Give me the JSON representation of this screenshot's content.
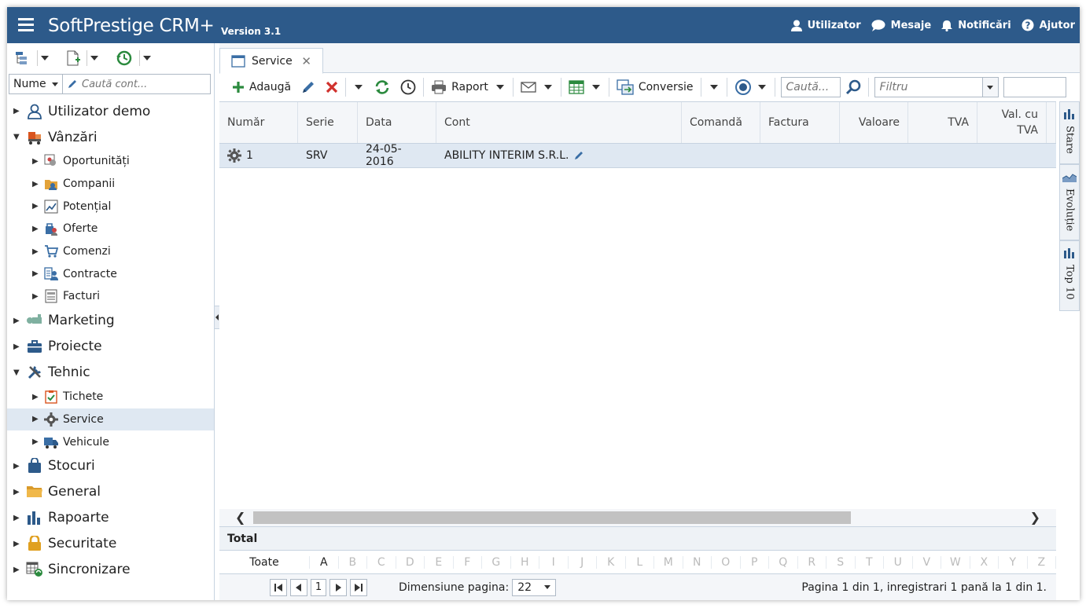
{
  "header": {
    "app_name": "SoftPrestige CRM+",
    "version": "Version 3.1",
    "menu": [
      {
        "label": "Utilizator",
        "icon": "user-icon"
      },
      {
        "label": "Mesaje",
        "icon": "chat-bubble-icon"
      },
      {
        "label": "Notificări",
        "icon": "bell-icon"
      },
      {
        "label": "Ajutor",
        "icon": "help-icon"
      }
    ],
    "bg_color": "#2d5a8a"
  },
  "sidebar": {
    "search": {
      "field": "Nume",
      "placeholder": "Caută cont..."
    },
    "tree": [
      {
        "label": "Utilizator demo",
        "level": 0,
        "expanded": false,
        "icon": "user-outline-icon"
      },
      {
        "label": "Vânzări",
        "level": 0,
        "expanded": true,
        "icon": "cart-icon"
      },
      {
        "label": "Oportunități",
        "level": 1,
        "icon": "opportunity-icon"
      },
      {
        "label": "Companii",
        "level": 1,
        "icon": "companies-icon"
      },
      {
        "label": "Potențial",
        "level": 1,
        "icon": "chart-line-icon"
      },
      {
        "label": "Oferte",
        "level": 1,
        "icon": "offers-icon"
      },
      {
        "label": "Comenzi",
        "level": 1,
        "icon": "shopping-cart-icon"
      },
      {
        "label": "Contracte",
        "level": 1,
        "icon": "contracts-icon"
      },
      {
        "label": "Facturi",
        "level": 1,
        "icon": "invoice-icon"
      },
      {
        "label": "Marketing",
        "level": 0,
        "expanded": false,
        "icon": "marketing-icon"
      },
      {
        "label": "Proiecte",
        "level": 0,
        "expanded": false,
        "icon": "briefcase-icon"
      },
      {
        "label": "Tehnic",
        "level": 0,
        "expanded": true,
        "icon": "tools-icon"
      },
      {
        "label": "Tichete",
        "level": 1,
        "icon": "ticket-icon"
      },
      {
        "label": "Service",
        "level": 1,
        "icon": "gear-icon",
        "active": true
      },
      {
        "label": "Vehicule",
        "level": 1,
        "icon": "truck-icon"
      },
      {
        "label": "Stocuri",
        "level": 0,
        "expanded": false,
        "icon": "bag-icon"
      },
      {
        "label": "General",
        "level": 0,
        "expanded": false,
        "icon": "folder-icon"
      },
      {
        "label": "Rapoarte",
        "level": 0,
        "expanded": false,
        "icon": "bar-chart-icon"
      },
      {
        "label": "Securitate",
        "level": 0,
        "expanded": false,
        "icon": "lock-icon"
      },
      {
        "label": "Sincronizare",
        "level": 0,
        "expanded": false,
        "icon": "sync-table-icon"
      }
    ]
  },
  "tab": {
    "label": "Service"
  },
  "toolbar": {
    "add": "Adaugă",
    "report": "Raport",
    "conversion": "Conversie",
    "search_placeholder": "Caută...",
    "filter_placeholder": "Filtru"
  },
  "grid": {
    "columns": [
      "Număr",
      "Serie",
      "Data",
      "Cont",
      "Comandă",
      "Factura",
      "Valoare",
      "TVA",
      "Val. cu TVA"
    ],
    "rows": [
      {
        "numar": "1",
        "serie": "SRV",
        "data": "24-05-2016",
        "cont": "ABILITY INTERIM S.R.L."
      }
    ],
    "total_label": "Total"
  },
  "letters": {
    "all": "Toate",
    "items": [
      "A",
      "B",
      "C",
      "D",
      "E",
      "F",
      "G",
      "H",
      "I",
      "J",
      "K",
      "L",
      "M",
      "N",
      "O",
      "P",
      "Q",
      "R",
      "S",
      "T",
      "U",
      "V",
      "W",
      "X",
      "Y",
      "Z"
    ]
  },
  "pager": {
    "page": "1",
    "size_label": "Dimensiune pagina:",
    "size": "22",
    "summary": "Pagina 1 din 1, inregistrari 1 pană la 1 din 1."
  },
  "side_tabs": [
    "Stare",
    "Evoluție",
    "Top 10"
  ]
}
